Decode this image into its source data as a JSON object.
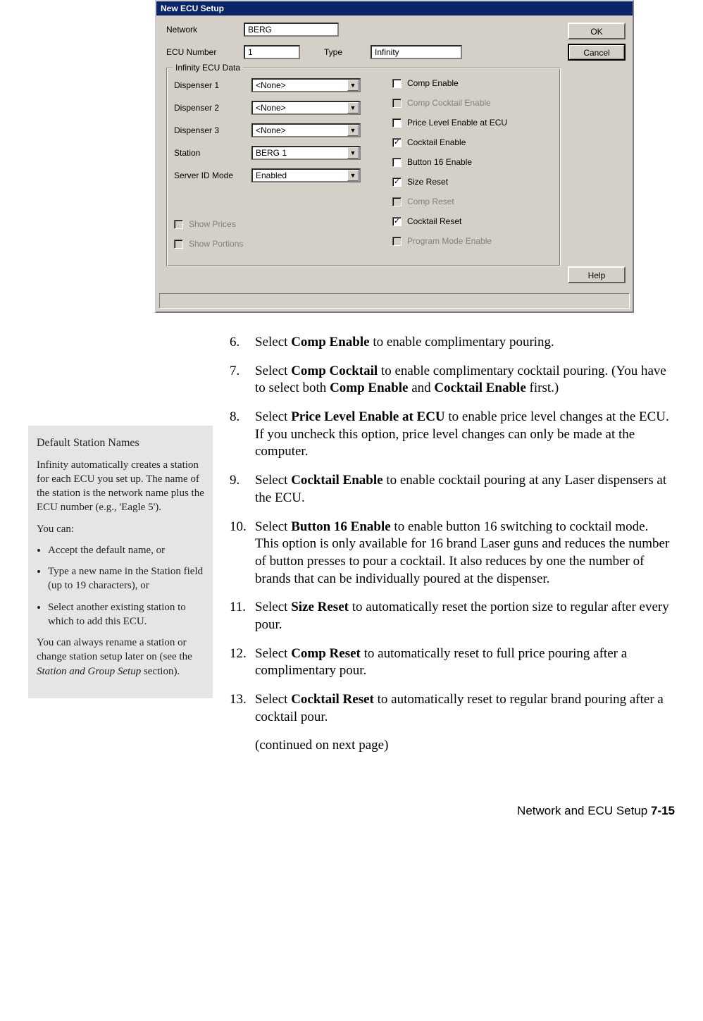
{
  "dialog": {
    "title": "New ECU Setup",
    "ok": "OK",
    "cancel": "Cancel",
    "help": "Help",
    "network_label": "Network",
    "network_value": "BERG",
    "ecu_num_label": "ECU Number",
    "ecu_num_value": "1",
    "type_label": "Type",
    "type_value": "Infinity",
    "group_title": "Infinity ECU Data",
    "disp1_label": "Dispenser 1",
    "disp1_value": "<None>",
    "disp2_label": "Dispenser 2",
    "disp2_value": "<None>",
    "disp3_label": "Dispenser 3",
    "disp3_value": "<None>",
    "station_label": "Station",
    "station_value": "BERG 1",
    "server_label": "Server ID Mode",
    "server_value": "Enabled",
    "chk_comp_enable": "Comp Enable",
    "chk_comp_cocktail": "Comp Cocktail Enable",
    "chk_price_level": "Price Level Enable at ECU",
    "chk_cocktail_enable": "Cocktail Enable",
    "chk_button16": "Button 16 Enable",
    "chk_size_reset": "Size Reset",
    "chk_comp_reset": "Comp Reset",
    "chk_cocktail_reset": "Cocktail Reset",
    "chk_program_mode": "Program Mode Enable",
    "chk_show_prices": "Show Prices",
    "chk_show_portions": "Show Portions"
  },
  "sidebar": {
    "title": "Default Station Names",
    "p1": "Infinity automatically creates a station for each ECU you set up. The name of the station is the network name plus the ECU number (e.g., 'Eagle 5').",
    "p2": "You can:",
    "b1": "Accept the default name, or",
    "b2": "Type a new name in the Station field (up to 19 characters), or",
    "b3": "Select another existing station to which to add this ECU.",
    "p3a": "You can always rename a station or change station setup later on (see the ",
    "p3_em": "Station and Group Setup",
    "p3b": " section)."
  },
  "steps": {
    "s6": {
      "num": "6.",
      "pre": "Select ",
      "b": "Comp Enable",
      "post": " to enable complimentary pouring."
    },
    "s7": {
      "num": "7.",
      "pre": "Select  ",
      "b1": "Comp Cocktail",
      "mid1": " to enable complimentary cocktail pouring. (You have to select both ",
      "b2": "Comp Enable",
      "mid2": " and ",
      "b3": "Cocktail Enable",
      "post": " first.)"
    },
    "s8": {
      "num": "8.",
      "pre": "Select ",
      "b": "Price Level Enable at ECU",
      "post": " to enable price level changes at the ECU. If you uncheck this option, price level changes can only be made at the computer."
    },
    "s9": {
      "num": "9.",
      "pre": "Select ",
      "b": "Cocktail Enable",
      "post": " to enable cocktail pouring at any Laser dispensers at the ECU."
    },
    "s10": {
      "num": "10.",
      "pre": "Select ",
      "b": "Button 16 Enable",
      "post": " to enable button 16 switching to cocktail mode. This option is only available for 16 brand Laser guns and reduces the number of button presses to pour a cocktail. It also reduces by one the number of brands that can be individually poured at the dispenser."
    },
    "s11": {
      "num": "11.",
      "pre": "Select ",
      "b": "Size Reset",
      "post": " to automatically reset the portion size to regular after every pour."
    },
    "s12": {
      "num": "12.",
      "pre": "Select ",
      "b": "Comp Reset",
      "post": " to automatically reset to full price pouring after a complimentary pour."
    },
    "s13": {
      "num": "13.",
      "pre": "Select ",
      "b": "Cocktail Reset",
      "post": " to automatically reset to regular brand pouring after a cocktail pour."
    },
    "continued": "(continued on next page)"
  },
  "footer": {
    "text": "Network and ECU Setup  ",
    "page": "7-15"
  }
}
